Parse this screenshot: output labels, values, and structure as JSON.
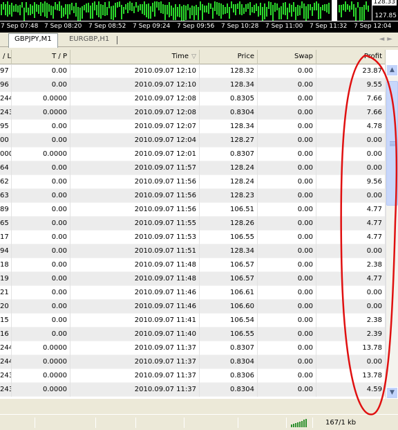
{
  "chart_strip": {
    "price_high": "128.33",
    "price_low": "127.85",
    "time_labels": [
      "7 Sep 07:48",
      "7 Sep 08:20",
      "7 Sep 08:52",
      "7 Sep 09:24",
      "7 Sep 09:56",
      "7 Sep 10:28",
      "7 Sep 11:00",
      "7 Sep 11:32",
      "7 Sep 12:04"
    ],
    "bar_color": "#2bd92b"
  },
  "tabs": [
    {
      "label": "GBPJPY,M1",
      "active": true
    },
    {
      "label": "EURGBP,H1",
      "active": false
    }
  ],
  "columns": {
    "sl": "/ L",
    "tp": "T / P",
    "time": "Time",
    "price": "Price",
    "swap": "Swap",
    "profit": "Profit"
  },
  "rows": [
    {
      "sl": "97",
      "tp": "0.00",
      "time": "2010.09.07 12:10",
      "price": "128.32",
      "swap": "0.00",
      "profit": "23.87"
    },
    {
      "sl": "96",
      "tp": "0.00",
      "time": "2010.09.07 12:10",
      "price": "128.34",
      "swap": "0.00",
      "profit": "9.55"
    },
    {
      "sl": "244",
      "tp": "0.0000",
      "time": "2010.09.07 12:08",
      "price": "0.8305",
      "swap": "0.00",
      "profit": "7.66"
    },
    {
      "sl": "243",
      "tp": "0.0000",
      "time": "2010.09.07 12:08",
      "price": "0.8304",
      "swap": "0.00",
      "profit": "7.66"
    },
    {
      "sl": "95",
      "tp": "0.00",
      "time": "2010.09.07 12:07",
      "price": "128.34",
      "swap": "0.00",
      "profit": "4.78"
    },
    {
      "sl": "00",
      "tp": "0.00",
      "time": "2010.09.07 12:04",
      "price": "128.27",
      "swap": "0.00",
      "profit": "0.00"
    },
    {
      "sl": "000",
      "tp": "0.0000",
      "time": "2010.09.07 12:01",
      "price": "0.8307",
      "swap": "0.00",
      "profit": "0.00"
    },
    {
      "sl": "64",
      "tp": "0.00",
      "time": "2010.09.07 11:57",
      "price": "128.24",
      "swap": "0.00",
      "profit": "0.00"
    },
    {
      "sl": "62",
      "tp": "0.00",
      "time": "2010.09.07 11:56",
      "price": "128.24",
      "swap": "0.00",
      "profit": "9.56"
    },
    {
      "sl": "63",
      "tp": "0.00",
      "time": "2010.09.07 11:56",
      "price": "128.23",
      "swap": "0.00",
      "profit": "0.00"
    },
    {
      "sl": "89",
      "tp": "0.00",
      "time": "2010.09.07 11:56",
      "price": "106.51",
      "swap": "0.00",
      "profit": "4.77"
    },
    {
      "sl": "65",
      "tp": "0.00",
      "time": "2010.09.07 11:55",
      "price": "128.26",
      "swap": "0.00",
      "profit": "4.77"
    },
    {
      "sl": "17",
      "tp": "0.00",
      "time": "2010.09.07 11:53",
      "price": "106.55",
      "swap": "0.00",
      "profit": "4.77"
    },
    {
      "sl": "94",
      "tp": "0.00",
      "time": "2010.09.07 11:51",
      "price": "128.34",
      "swap": "0.00",
      "profit": "0.00"
    },
    {
      "sl": "18",
      "tp": "0.00",
      "time": "2010.09.07 11:48",
      "price": "106.57",
      "swap": "0.00",
      "profit": "2.38"
    },
    {
      "sl": "19",
      "tp": "0.00",
      "time": "2010.09.07 11:48",
      "price": "106.57",
      "swap": "0.00",
      "profit": "4.77"
    },
    {
      "sl": "21",
      "tp": "0.00",
      "time": "2010.09.07 11:46",
      "price": "106.61",
      "swap": "0.00",
      "profit": "0.00"
    },
    {
      "sl": "20",
      "tp": "0.00",
      "time": "2010.09.07 11:46",
      "price": "106.60",
      "swap": "0.00",
      "profit": "0.00"
    },
    {
      "sl": "15",
      "tp": "0.00",
      "time": "2010.09.07 11:41",
      "price": "106.54",
      "swap": "0.00",
      "profit": "2.38"
    },
    {
      "sl": "16",
      "tp": "0.00",
      "time": "2010.09.07 11:40",
      "price": "106.55",
      "swap": "0.00",
      "profit": "2.39"
    },
    {
      "sl": "244",
      "tp": "0.0000",
      "time": "2010.09.07 11:37",
      "price": "0.8307",
      "swap": "0.00",
      "profit": "13.78"
    },
    {
      "sl": "244",
      "tp": "0.0000",
      "time": "2010.09.07 11:37",
      "price": "0.8304",
      "swap": "0.00",
      "profit": "0.00"
    },
    {
      "sl": "243",
      "tp": "0.0000",
      "time": "2010.09.07 11:37",
      "price": "0.8306",
      "swap": "0.00",
      "profit": "13.78"
    },
    {
      "sl": "243",
      "tp": "0.0000",
      "time": "2010.09.07 11:37",
      "price": "0.8304",
      "swap": "0.00",
      "profit": "4.59"
    }
  ],
  "statusbar": {
    "traffic": "167/1 kb",
    "connection_icon": "connection-bars-icon"
  },
  "annotation_color": "#e01010"
}
